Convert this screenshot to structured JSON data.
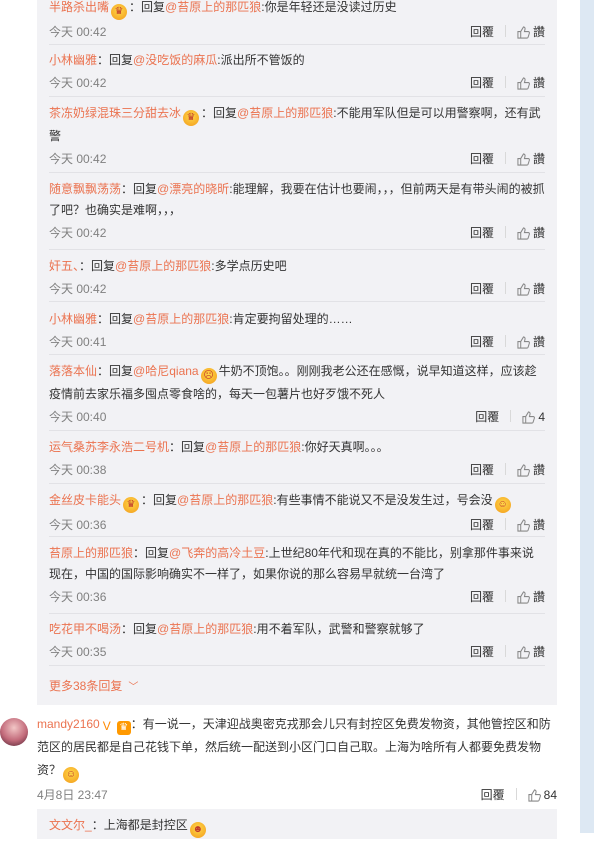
{
  "labels": {
    "reply": "回覆",
    "reply_prefix": "回复",
    "like": "讚"
  },
  "replies": [
    {
      "user": "半路杀出嘴",
      "badge": "crown",
      "mention": "@苔原上的那匹狼",
      "text": ":你是年轻还是没读过历史",
      "time": "今天 00:42"
    },
    {
      "user": "小林幽雅",
      "mention": "@没吃饭的麻瓜",
      "text": ":派出所不管饭的",
      "time": "今天 00:42"
    },
    {
      "user": "茶冻奶绿混珠三分甜去冰",
      "badge": "crown",
      "mention": "@苔原上的那匹狼",
      "text": ":不能用军队但是可以用警察啊，还有武警",
      "time": "今天 00:42"
    },
    {
      "user": "随意飘飘荡荡",
      "mention": "@漂亮的晓昕",
      "text": ":能理解，我要在估计也要闹，，，但前两天是有带头闹的被抓了吧？也确实是难啊，，，",
      "time": "今天 00:42"
    },
    {
      "user": "奸五、",
      "mention": "@苔原上的那匹狼",
      "text": ":多学点历史吧",
      "time": "今天 00:42"
    },
    {
      "user": "小林幽雅",
      "mention": "@苔原上的那匹狼",
      "text": ":肯定要拘留处理的……",
      "time": "今天 00:41"
    },
    {
      "user": "落落本仙",
      "mention": "@哈尼qiana",
      "text_after_emoji": "牛奶不顶饱。。刚刚我老公还在感慨，说早知道这样，应该趁疫情前去家乐福多囤点零食啥的，每天一包薯片也好歹饿不死人",
      "time": "今天 00:40",
      "likes": "4"
    },
    {
      "user": "运气桑苏李永浩二号机",
      "mention": "@苔原上的那匹狼",
      "text": ":你好天真啊。。。",
      "time": "今天 00:38"
    },
    {
      "user": "金丝皮卡能头",
      "badge": "crown",
      "mention": "@苔原上的那匹狼",
      "text": ":有些事情不能说又不是没发生过，号会没",
      "time": "今天 00:36"
    },
    {
      "user": "苔原上的那匹狼",
      "mention": "@飞奔的高冷土豆",
      "text": ":上世纪80年代和现在真的不能比，别拿那件事来说现在，中国的国际影响确实不一样了，如果你说的那么容易早就统一台湾了",
      "time": "今天 00:36"
    },
    {
      "user": "吃花甲不喝汤",
      "mention": "@苔原上的那匹狼",
      "text": ":用不着军队，武警和警察就够了",
      "time": "今天 00:35"
    }
  ],
  "more_replies": "更多38条回复",
  "comment": {
    "user": "mandy2160",
    "text": "：有一说一，天津迎战奥密克戎那会儿只有封控区免费发物资，其他管控区和防范区的居民都是自己花钱下单，然后统一配送到小区门口自己取。上海为啥所有人都要免费发物资？",
    "time": "4月8日 23:47",
    "likes": "84"
  },
  "sub_reply": {
    "user": "文文尔_",
    "text": "：上海都是封控区"
  }
}
